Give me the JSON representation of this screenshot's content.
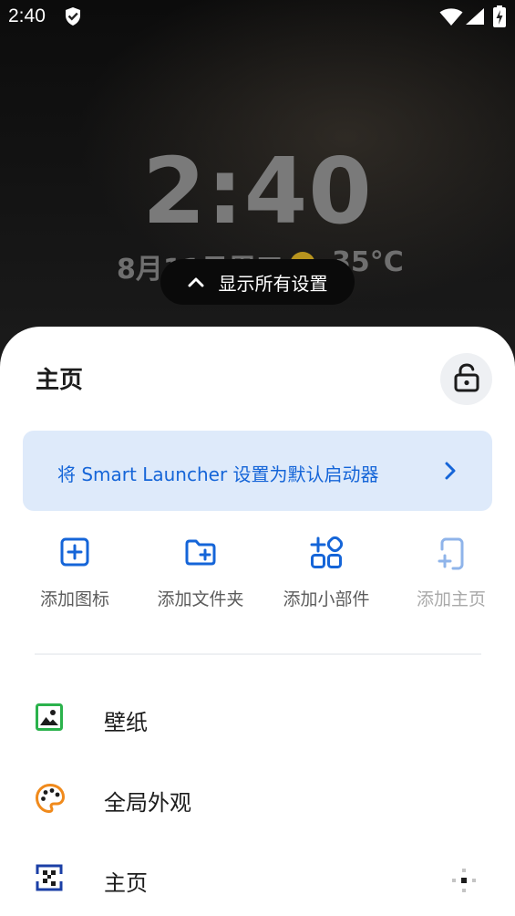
{
  "status_bar": {
    "time": "2:40"
  },
  "home": {
    "clock": "2:40",
    "date": "8月11日周三",
    "temperature": "35°C"
  },
  "settings_pill": {
    "label": "显示所有设置"
  },
  "sheet": {
    "title": "主页",
    "default_banner": "将 Smart Launcher 设置为默认启动器",
    "quick_actions": [
      {
        "label": "添加图标",
        "icon": "add-square-icon",
        "enabled": true
      },
      {
        "label": "添加文件夹",
        "icon": "add-folder-icon",
        "enabled": true
      },
      {
        "label": "添加小部件",
        "icon": "add-widget-icon",
        "enabled": true
      },
      {
        "label": "添加主页",
        "icon": "add-page-icon",
        "enabled": false
      }
    ],
    "menu": [
      {
        "label": "壁纸",
        "icon": "wallpaper-icon"
      },
      {
        "label": "全局外观",
        "icon": "palette-icon"
      },
      {
        "label": "主页",
        "icon": "home-grid-icon"
      }
    ]
  },
  "colors": {
    "accent": "#1565d8",
    "banner_bg": "#deeafa",
    "wallpaper_icon": "#2bb24c",
    "palette_icon": "#f08a1c",
    "home_grid_icon": "#1b3fa6"
  }
}
